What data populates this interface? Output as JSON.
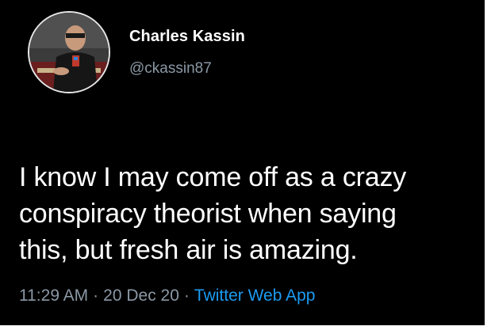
{
  "user": {
    "display_name": "Charles Kassin",
    "handle": "@ckassin87"
  },
  "tweet": {
    "lines": [
      "I know I may come off as a crazy",
      "conspiracy theorist when saying",
      "this, but fresh air is amazing."
    ],
    "time": "11:29 AM",
    "date": "20 Dec 20",
    "separator": "·",
    "source": "Twitter Web App"
  },
  "colors": {
    "background": "#000000",
    "primary_text": "#ffffff",
    "secondary_text": "#8b98a5",
    "link": "#1d9bf0"
  }
}
